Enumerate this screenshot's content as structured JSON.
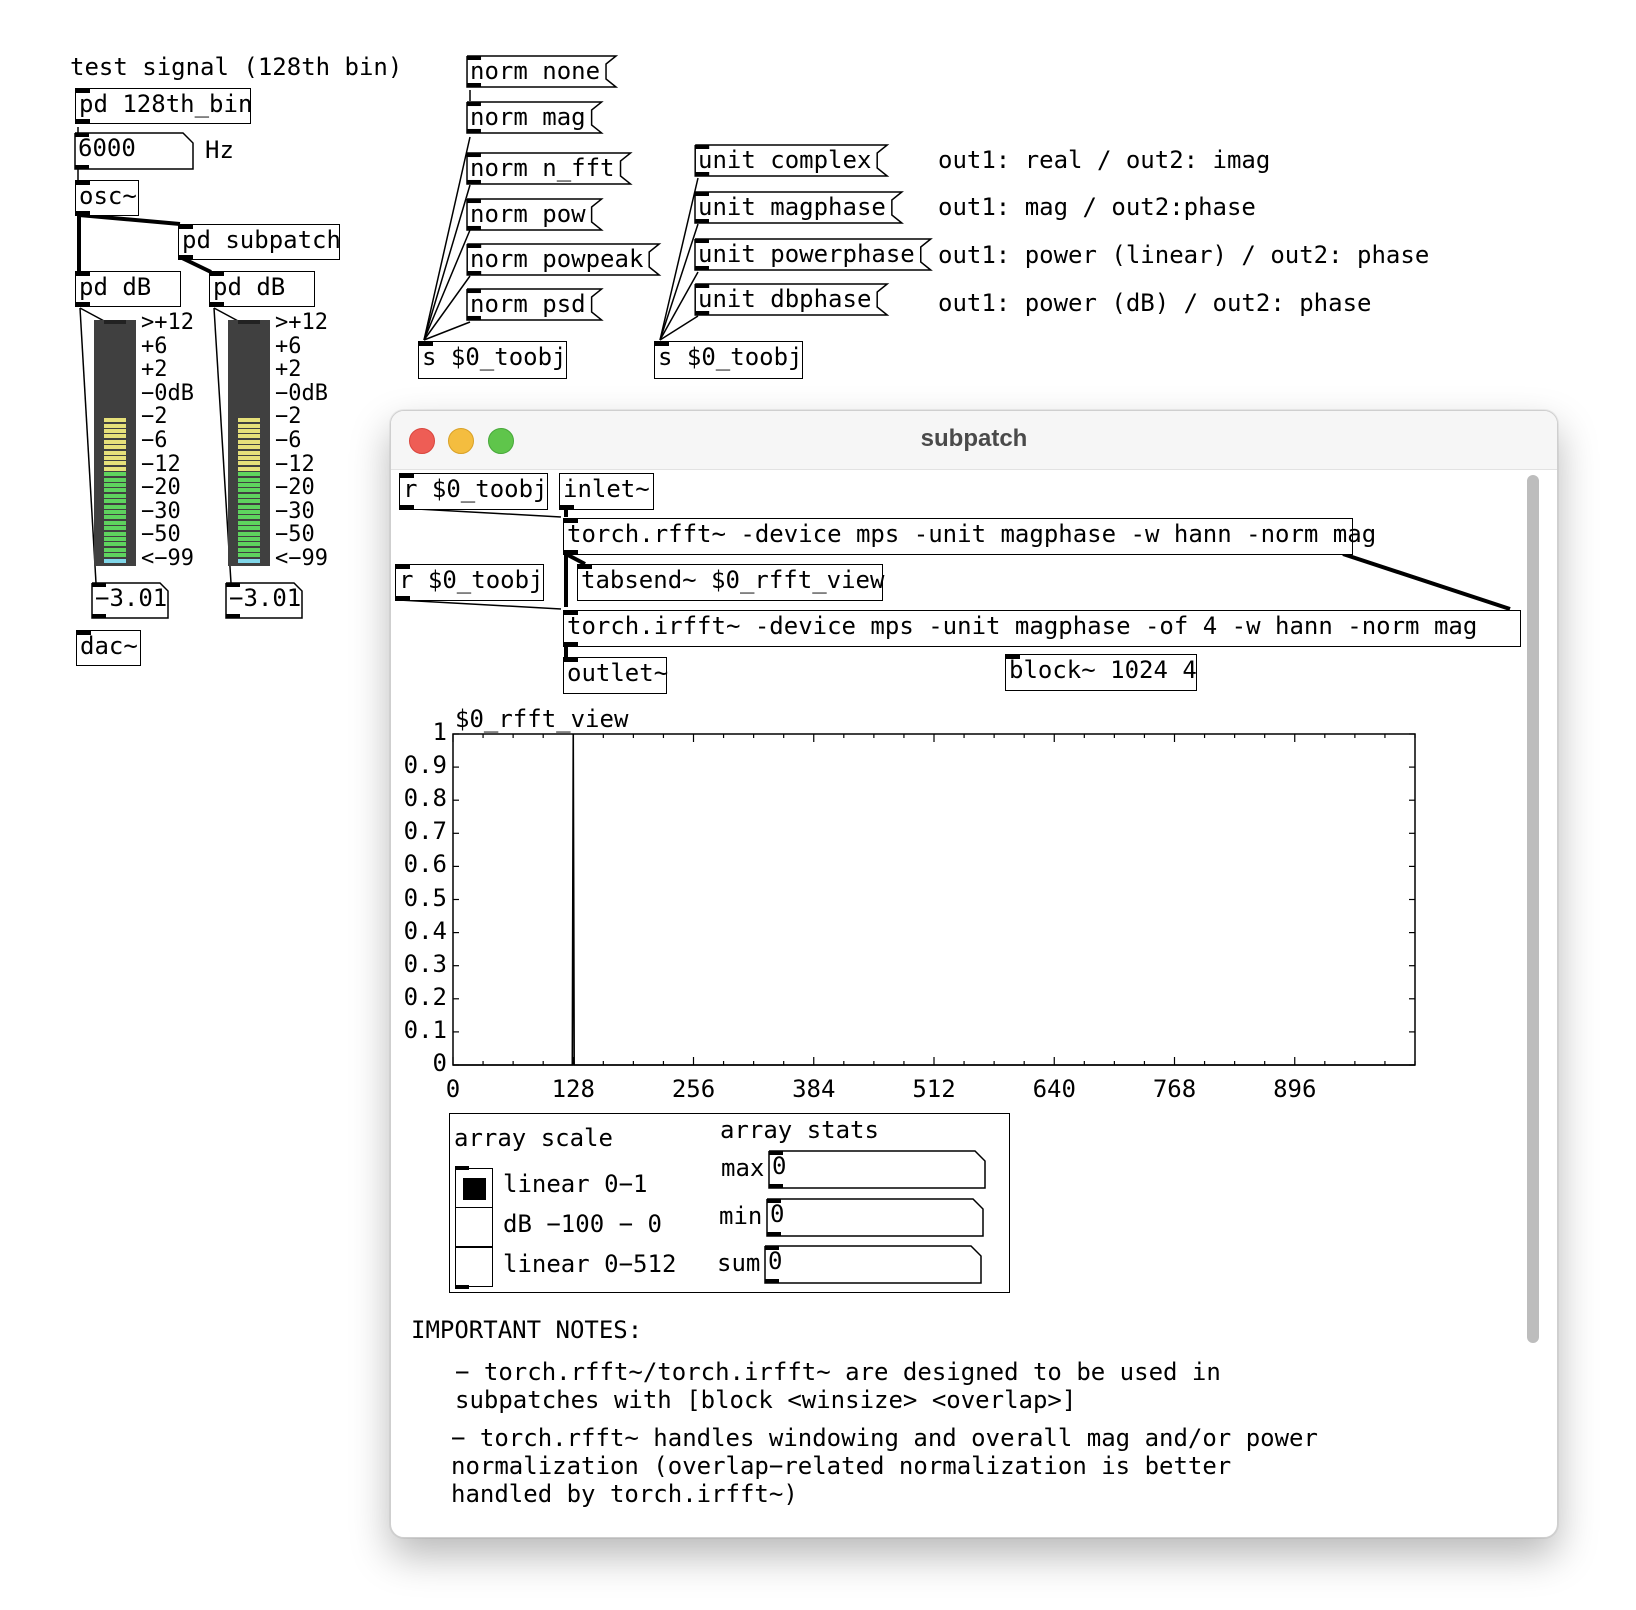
{
  "main_patch": {
    "comment_test_signal": "test signal (128th bin)",
    "obj_128th_bin": "pd 128th_bin",
    "freq_number": "6000",
    "hz_label": "Hz",
    "obj_osc": "osc~",
    "obj_subpatch": "pd subpatch",
    "obj_pd_db_left": "pd dB",
    "obj_pd_db_right": "pd dB",
    "vu_scale": [
      ">+12",
      "+6",
      "+2",
      "−0dB",
      "−2",
      "−6",
      "−12",
      "−20",
      "−30",
      "−50",
      "<−99"
    ],
    "level_left": "−3.01",
    "level_right": "−3.01",
    "obj_dac": "dac~",
    "norm_messages": [
      "norm none",
      "norm mag",
      "norm n_fft",
      "norm pow",
      "norm powpeak",
      "norm psd"
    ],
    "send_norm": "s $0_toobj",
    "unit_messages": [
      "unit complex",
      "unit magphase",
      "unit powerphase",
      "unit dbphase"
    ],
    "send_unit": "s $0_toobj",
    "unit_comments": [
      "out1: real / out2: imag",
      "out1: mag / out2:phase",
      "out1: power (linear) / out2: phase",
      "out1: power (dB) / out2: phase"
    ]
  },
  "subpatch_window": {
    "title": "subpatch",
    "recv1": "r $0_toobj",
    "inlet": "inlet~",
    "rfft": "torch.rfft~ -device mps -unit magphase -w hann -norm mag",
    "tabsend": "tabsend~ $0_rfft_view",
    "recv2": "r $0_toobj",
    "irfft": "torch.irfft~ -device mps -unit magphase -of 4 -w hann -norm mag",
    "outlet": "outlet~",
    "block": "block~ 1024 4",
    "array_name": "$0_rfft_view",
    "y_ticks": [
      "1",
      "0.9",
      "0.8",
      "0.7",
      "0.6",
      "0.5",
      "0.4",
      "0.3",
      "0.2",
      "0.1",
      "0"
    ],
    "x_ticks": [
      "0",
      "128",
      "256",
      "384",
      "512",
      "640",
      "768",
      "896"
    ],
    "array_scale_label": "array scale",
    "scale_options": [
      "linear 0−1",
      "dB −100 − 0",
      "linear 0−512"
    ],
    "scale_selected_index": 0,
    "array_stats_label": "array stats",
    "stat_max_label": "max",
    "stat_max_value": "0",
    "stat_min_label": "min",
    "stat_min_value": "0",
    "stat_sum_label": "sum",
    "stat_sum_value": "0",
    "notes_title": "IMPORTANT NOTES:",
    "note1": "− torch.rfft~/torch.irfft~ are designed to be used in\nsubpatches with [block <winsize> <overlap>]",
    "note2": "− torch.rfft~ handles windowing and overall mag and/or power\nnormalization (overlap−related normalization is better\nhandled by torch.irfft~)"
  },
  "chart_data": {
    "type": "line",
    "title": "$0_rfft_view",
    "xlabel": "",
    "ylabel": "",
    "xlim": [
      0,
      1024
    ],
    "ylim": [
      0,
      1
    ],
    "x_ticks": [
      0,
      128,
      256,
      384,
      512,
      640,
      768,
      896
    ],
    "y_ticks": [
      0,
      0.1,
      0.2,
      0.3,
      0.4,
      0.5,
      0.6,
      0.7,
      0.8,
      0.9,
      1
    ],
    "series": [
      {
        "x": [
          0,
          127,
          128,
          129,
          1024
        ],
        "y": [
          0,
          0,
          1,
          0,
          0
        ]
      }
    ],
    "grid": false
  },
  "colors": {
    "vu_background": "#404040",
    "vu_green": "#5ed35e",
    "vu_yellow": "#e6e07a",
    "vu_cyan": "#7fd6e8",
    "traffic_red": "#ee5d55",
    "traffic_yellow": "#f4bd3f",
    "traffic_green": "#5fc54b"
  }
}
